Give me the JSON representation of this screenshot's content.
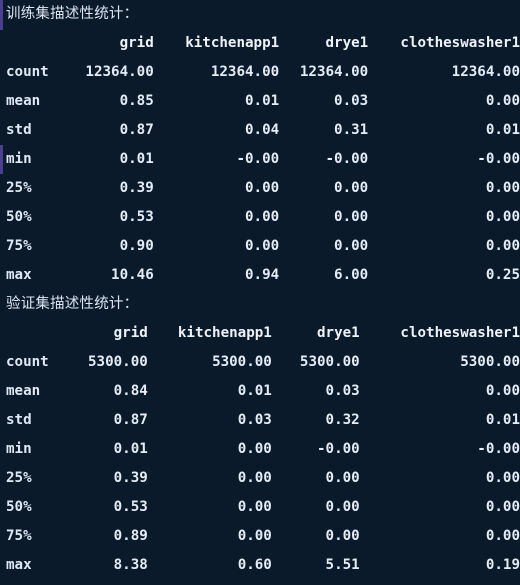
{
  "theme": {
    "background": "#0b1a2b",
    "text": "#e3ecf7",
    "accent": "#4b3f8f"
  },
  "sections": [
    {
      "id": "train",
      "title": "训练集描述性统计：",
      "columns": [
        "grid",
        "kitchenapp1",
        "drye1",
        "clotheswasher1"
      ],
      "index_label": "",
      "rows": [
        {
          "stat": "count",
          "values": [
            "12364.00",
            "12364.00",
            "12364.00",
            "12364.00"
          ]
        },
        {
          "stat": "mean",
          "values": [
            "0.85",
            "0.01",
            "0.03",
            "0.00"
          ]
        },
        {
          "stat": "std",
          "values": [
            "0.87",
            "0.04",
            "0.31",
            "0.01"
          ]
        },
        {
          "stat": "min",
          "values": [
            "0.01",
            "-0.00",
            "-0.00",
            "-0.00"
          ]
        },
        {
          "stat": "25%",
          "values": [
            "0.39",
            "0.00",
            "0.00",
            "0.00"
          ]
        },
        {
          "stat": "50%",
          "values": [
            "0.53",
            "0.00",
            "0.00",
            "0.00"
          ]
        },
        {
          "stat": "75%",
          "values": [
            "0.90",
            "0.00",
            "0.00",
            "0.00"
          ]
        },
        {
          "stat": "max",
          "values": [
            "10.46",
            "0.94",
            "6.00",
            "0.25"
          ]
        }
      ]
    },
    {
      "id": "validation",
      "title": "验证集描述性统计：",
      "columns": [
        "grid",
        "kitchenapp1",
        "drye1",
        "clotheswasher1"
      ],
      "index_label": "",
      "rows": [
        {
          "stat": "count",
          "values": [
            "5300.00",
            "5300.00",
            "5300.00",
            "5300.00"
          ]
        },
        {
          "stat": "mean",
          "values": [
            "0.84",
            "0.01",
            "0.03",
            "0.00"
          ]
        },
        {
          "stat": "std",
          "values": [
            "0.87",
            "0.03",
            "0.32",
            "0.01"
          ]
        },
        {
          "stat": "min",
          "values": [
            "0.01",
            "0.00",
            "-0.00",
            "-0.00"
          ]
        },
        {
          "stat": "25%",
          "values": [
            "0.39",
            "0.00",
            "0.00",
            "0.00"
          ]
        },
        {
          "stat": "50%",
          "values": [
            "0.53",
            "0.00",
            "0.00",
            "0.00"
          ]
        },
        {
          "stat": "75%",
          "values": [
            "0.89",
            "0.00",
            "0.00",
            "0.00"
          ]
        },
        {
          "stat": "max",
          "values": [
            "8.38",
            "0.60",
            "5.51",
            "0.19"
          ]
        }
      ]
    }
  ]
}
